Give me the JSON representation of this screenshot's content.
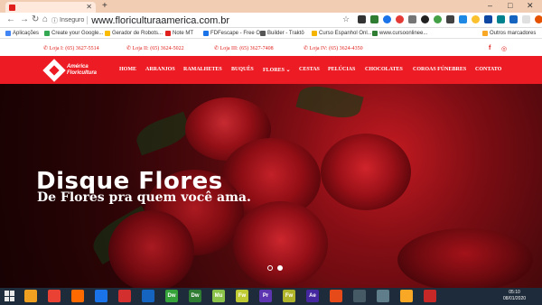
{
  "browser": {
    "tab_title": "",
    "new_tab_symbol": "+",
    "window_controls": [
      "–",
      "□",
      "✕"
    ],
    "security_label": "Inseguro",
    "url": "www.floriculturaamerica.com.br",
    "bookmarks": [
      {
        "label": "Aplicações",
        "color": "#4285f4"
      },
      {
        "label": "Create your Google...",
        "color": "#34a853"
      },
      {
        "label": "Gerador de Robots...",
        "color": "#fbbc05"
      },
      {
        "label": "Note MT",
        "color": "#e0201c"
      },
      {
        "label": "FDFescape - Free O...",
        "color": "#1a73e8"
      },
      {
        "label": "Builder - Traktö",
        "color": "#555555"
      },
      {
        "label": "Curso Espanhol Onl...",
        "color": "#f4b400"
      },
      {
        "label": "www.cursoonlinee...",
        "color": "#2e7d32"
      }
    ],
    "other_bookmarks": "Outros marcadores"
  },
  "site": {
    "stores": [
      "Loja I: (65) 3627-5514",
      "Loja II: (65) 3624-5022",
      "Loja III: (65) 3627-7408",
      "Loja IV: (65) 3624-4350"
    ],
    "logo_text": [
      "América",
      "Floricultura"
    ],
    "nav": [
      "HOME",
      "ARRANJOS",
      "RAMALHETES",
      "BUQUÊS",
      "FLORES ⌄",
      "CESTAS",
      "PELÚCIAS",
      "CHOCOLATES",
      "COROAS FÚNEBRES",
      "CONTATO"
    ],
    "hero": {
      "title": "Disque Flores",
      "subtitle": "De Flores pra quem você ama."
    },
    "colors": {
      "brand_red": "#ed1c24"
    }
  },
  "taskbar": {
    "apps": [
      {
        "label": "",
        "color": "#f0a020"
      },
      {
        "label": "",
        "color": "#e94235"
      },
      {
        "label": "",
        "color": "#ff6a00"
      },
      {
        "label": "",
        "color": "#1a73e8"
      },
      {
        "label": "",
        "color": "#d32f2f"
      },
      {
        "label": "",
        "color": "#1565c0"
      },
      {
        "label": "Dw",
        "color": "#35a33a"
      },
      {
        "label": "Dw",
        "color": "#2e7d32"
      },
      {
        "label": "Mu",
        "color": "#8bc34a"
      },
      {
        "label": "Fw",
        "color": "#c0ca33"
      },
      {
        "label": "Pr",
        "color": "#5e35b1"
      },
      {
        "label": "Fw",
        "color": "#afb42b"
      },
      {
        "label": "Ae",
        "color": "#4527a0"
      },
      {
        "label": "",
        "color": "#e64a19"
      },
      {
        "label": "",
        "color": "#455a64"
      },
      {
        "label": "",
        "color": "#607d8b"
      },
      {
        "label": "",
        "color": "#f9a825"
      },
      {
        "label": "",
        "color": "#c62828"
      }
    ],
    "clock_time": "05:10",
    "clock_date": "08/01/2020"
  }
}
